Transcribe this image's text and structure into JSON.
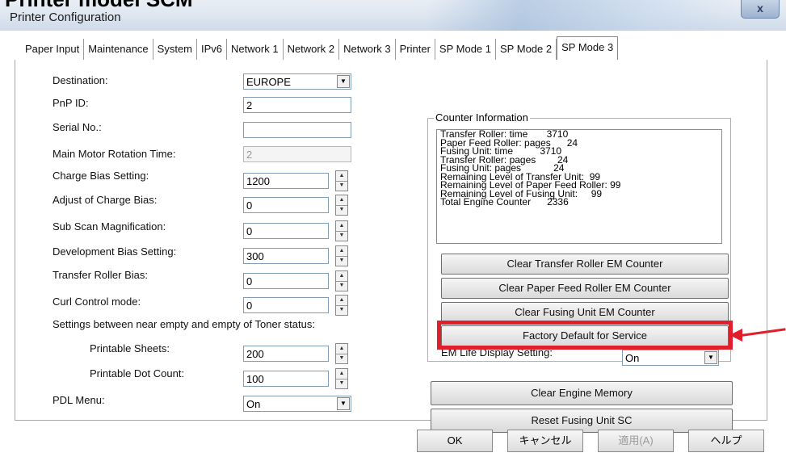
{
  "overlay": {
    "heading": "Printer model SCM"
  },
  "window": {
    "title": "Printer Configuration",
    "close_glyph": "x"
  },
  "tabs": [
    {
      "label": "Paper Input"
    },
    {
      "label": "Maintenance"
    },
    {
      "label": "System"
    },
    {
      "label": "IPv6"
    },
    {
      "label": "Network 1"
    },
    {
      "label": "Network 2"
    },
    {
      "label": "Network 3"
    },
    {
      "label": "Printer"
    },
    {
      "label": "SP Mode 1"
    },
    {
      "label": "SP Mode 2"
    },
    {
      "label": "SP Mode 3",
      "active": true
    }
  ],
  "settings": {
    "destination": {
      "label": "Destination:",
      "value": "EUROPE"
    },
    "pnp_id": {
      "label": "PnP ID:",
      "value": "2"
    },
    "serial_no": {
      "label": "Serial No.:",
      "value": ""
    },
    "main_motor": {
      "label": "Main Motor Rotation Time:",
      "value": "2"
    },
    "charge_bias": {
      "label": "Charge Bias Setting:",
      "value": "1200"
    },
    "adjust_charge_bias": {
      "label": "Adjust of Charge Bias:",
      "value": "0"
    },
    "sub_scan": {
      "label": "Sub Scan Magnification:",
      "value": "0"
    },
    "development_bias": {
      "label": "Development Bias Setting:",
      "value": "300"
    },
    "transfer_roller_bias": {
      "label": "Transfer Roller Bias:",
      "value": "0"
    },
    "curl_control": {
      "label": "Curl Control mode:",
      "value": "0"
    },
    "toner_status_heading": "Settings between near empty and empty of Toner status:",
    "printable_sheets": {
      "label": "Printable Sheets:",
      "value": "200"
    },
    "printable_dot_count": {
      "label": "Printable Dot Count:",
      "value": "100"
    },
    "pdl_menu": {
      "label": "PDL Menu:",
      "value": "On"
    }
  },
  "counter": {
    "legend": "Counter Information",
    "rows": [
      "Transfer Roller: time       3710",
      "Paper Feed Roller: pages      24",
      "Fusing Unit: time          3710",
      "Transfer Roller: pages        24",
      "Fusing Unit: pages            24",
      "Remaining Level of Transfer Unit:  99",
      "Remaining Level of Paper Feed Roller: 99",
      "Remaining Level of Fusing Unit:     99",
      "Total Engine Counter      2336"
    ],
    "buttons": {
      "clear_transfer": "Clear Transfer Roller EM Counter",
      "clear_paper_feed": "Clear Paper Feed Roller EM Counter",
      "clear_fusing": "Clear Fusing Unit EM Counter",
      "factory_default": "Factory Default for Service"
    },
    "em_life": {
      "label": "EM Life Display Setting:",
      "value": "On"
    }
  },
  "engine_buttons": {
    "clear_engine_memory": "Clear Engine Memory",
    "reset_fusing_sc": "Reset Fusing Unit SC"
  },
  "footer": {
    "ok": "OK",
    "cancel": "キャンセル",
    "apply": "適用(A)",
    "help": "ヘルプ"
  },
  "colors": {
    "highlight": "#e11e2c",
    "field_border": "#7f9db9"
  }
}
